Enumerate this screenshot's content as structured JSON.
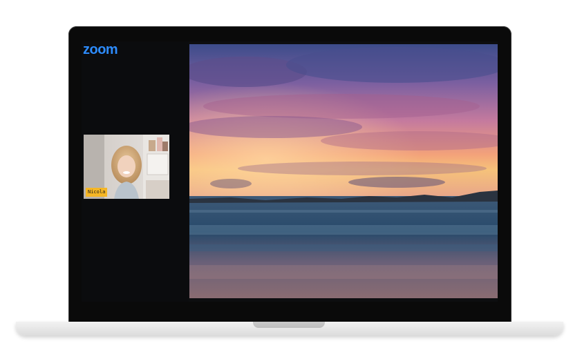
{
  "app": {
    "logo_text": "zoom",
    "brand_color": "#2d8cff"
  },
  "participant": {
    "name": "Nicola",
    "name_tag_color": "#f5b626"
  },
  "shared_content": {
    "description_icon": "image-icon"
  }
}
